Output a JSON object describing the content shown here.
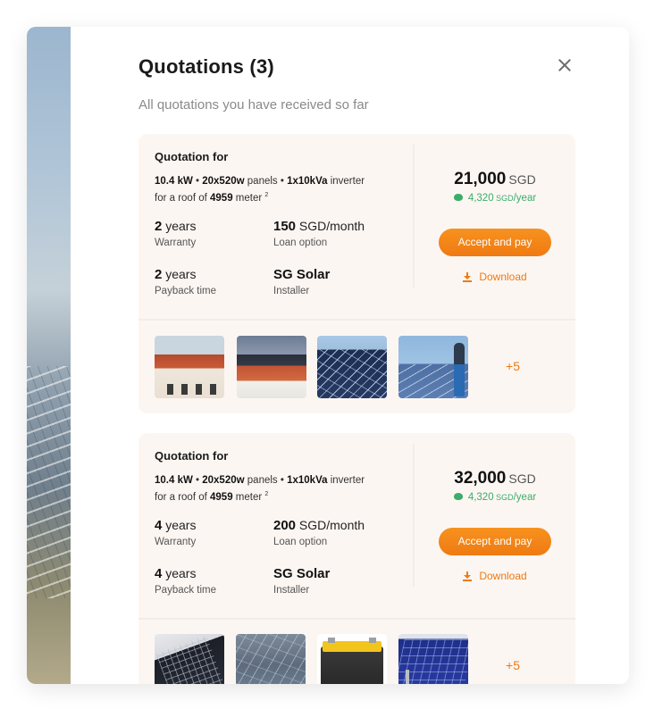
{
  "dialog": {
    "title": "Quotations (3)",
    "subtitle": "All quotations you have received so far",
    "close_icon": "close-icon"
  },
  "quotations": [
    {
      "heading": "Quotation for",
      "spec": {
        "kw": "10.4 kW",
        "sep1": " • ",
        "panels_qty": "20x520w",
        "panels_word": " panels",
        "sep2": " • ",
        "inverter_qty": "1x10kVa",
        "inverter_word": " inverter",
        "roof_prefix": "for a roof of ",
        "roof_value": "4959",
        "roof_unit": " meter",
        "roof_sup": "2"
      },
      "warranty": {
        "value": "2",
        "unit": " years",
        "label": "Warranty"
      },
      "loan": {
        "value": "150",
        "unit": " SGD/month",
        "label": "Loan option"
      },
      "payback": {
        "value": "2",
        "unit": " years",
        "label": "Payback time"
      },
      "installer": {
        "value": "SG Solar",
        "label": "Installer"
      },
      "price": {
        "value": "21,000",
        "currency": "SGD"
      },
      "saving": {
        "value": "4,320",
        "unit_small": " SGD",
        "unit": "/year"
      },
      "accept_label": "Accept and pay",
      "download_label": "Download",
      "more_label": "+5",
      "thumbnails": [
        "house-photo",
        "roof-solar-photo",
        "solar-panels-photo",
        "solar-worker-photo"
      ]
    },
    {
      "heading": "Quotation for",
      "spec": {
        "kw": "10.4 kW",
        "sep1": " • ",
        "panels_qty": "20x520w",
        "panels_word": " panels",
        "sep2": " • ",
        "inverter_qty": "1x10kVa",
        "inverter_word": " inverter",
        "roof_prefix": "for a roof of ",
        "roof_value": "4959",
        "roof_unit": " meter",
        "roof_sup": "2"
      },
      "warranty": {
        "value": "4",
        "unit": " years",
        "label": "Warranty"
      },
      "loan": {
        "value": "200",
        "unit": " SGD/month",
        "label": "Loan option"
      },
      "payback": {
        "value": "4",
        "unit": " years",
        "label": "Payback time"
      },
      "installer": {
        "value": "SG Solar",
        "label": "Installer"
      },
      "price": {
        "value": "32,000",
        "currency": "SGD"
      },
      "saving": {
        "value": "4,320",
        "unit_small": " SGD",
        "unit": "/year"
      },
      "accept_label": "Accept and pay",
      "download_label": "Download",
      "more_label": "+5",
      "thumbnails": [
        "hand-panel-photo",
        "roof-panels-photo",
        "battery-photo",
        "blue-panel-photo"
      ]
    }
  ],
  "colors": {
    "accent": "#ef7a12",
    "saving_green": "#3aad6a",
    "card_bg": "#fcf6f2"
  }
}
